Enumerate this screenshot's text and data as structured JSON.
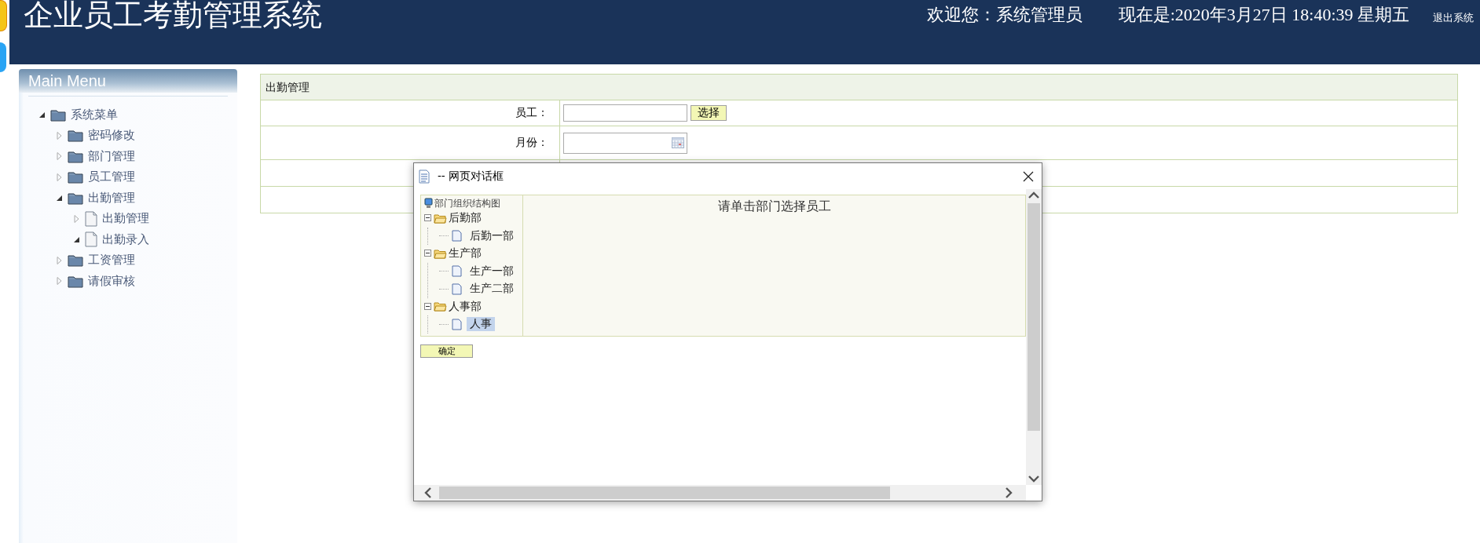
{
  "header": {
    "title": "企业员工考勤管理系统",
    "welcome": "欢迎您：系统管理员",
    "datetime": "现在是:2020年3月27日 18:40:39 星期五",
    "logout": "退出系统"
  },
  "sidebar": {
    "title": "Main Menu",
    "tree": [
      {
        "label": "系统菜单",
        "kind": "folder",
        "expanded": true,
        "children": [
          {
            "label": "密码修改",
            "kind": "folder",
            "expanded": false
          },
          {
            "label": "部门管理",
            "kind": "folder",
            "expanded": false
          },
          {
            "label": "员工管理",
            "kind": "folder",
            "expanded": false
          },
          {
            "label": "出勤管理",
            "kind": "folder",
            "expanded": true,
            "children": [
              {
                "label": "出勤管理",
                "kind": "page",
                "expanded": false
              },
              {
                "label": "出勤录入",
                "kind": "page",
                "expanded": true
              }
            ]
          },
          {
            "label": "工资管理",
            "kind": "folder",
            "expanded": false
          },
          {
            "label": "请假审核",
            "kind": "folder",
            "expanded": false
          }
        ]
      }
    ]
  },
  "form": {
    "title": "出勤管理",
    "rows": [
      {
        "kind": "picker",
        "label": "员工：",
        "button": "选择"
      },
      {
        "kind": "date",
        "label": "月份："
      },
      {
        "kind": "blank"
      },
      {
        "kind": "blank"
      }
    ]
  },
  "dialog": {
    "title": "-- 网页对话框",
    "tree": {
      "label": "部门组织结构图",
      "children": [
        {
          "label": "后勤部",
          "expanded": true,
          "children": [
            {
              "label": "后勤一部",
              "selected": false
            }
          ]
        },
        {
          "label": "生产部",
          "expanded": true,
          "children": [
            {
              "label": "生产一部",
              "selected": false
            },
            {
              "label": "生产二部",
              "selected": false
            }
          ]
        },
        {
          "label": "人事部",
          "expanded": true,
          "children": [
            {
              "label": "人事",
              "selected": true
            }
          ]
        }
      ]
    },
    "message": "请单击部门选择员工",
    "confirm": "确定"
  }
}
